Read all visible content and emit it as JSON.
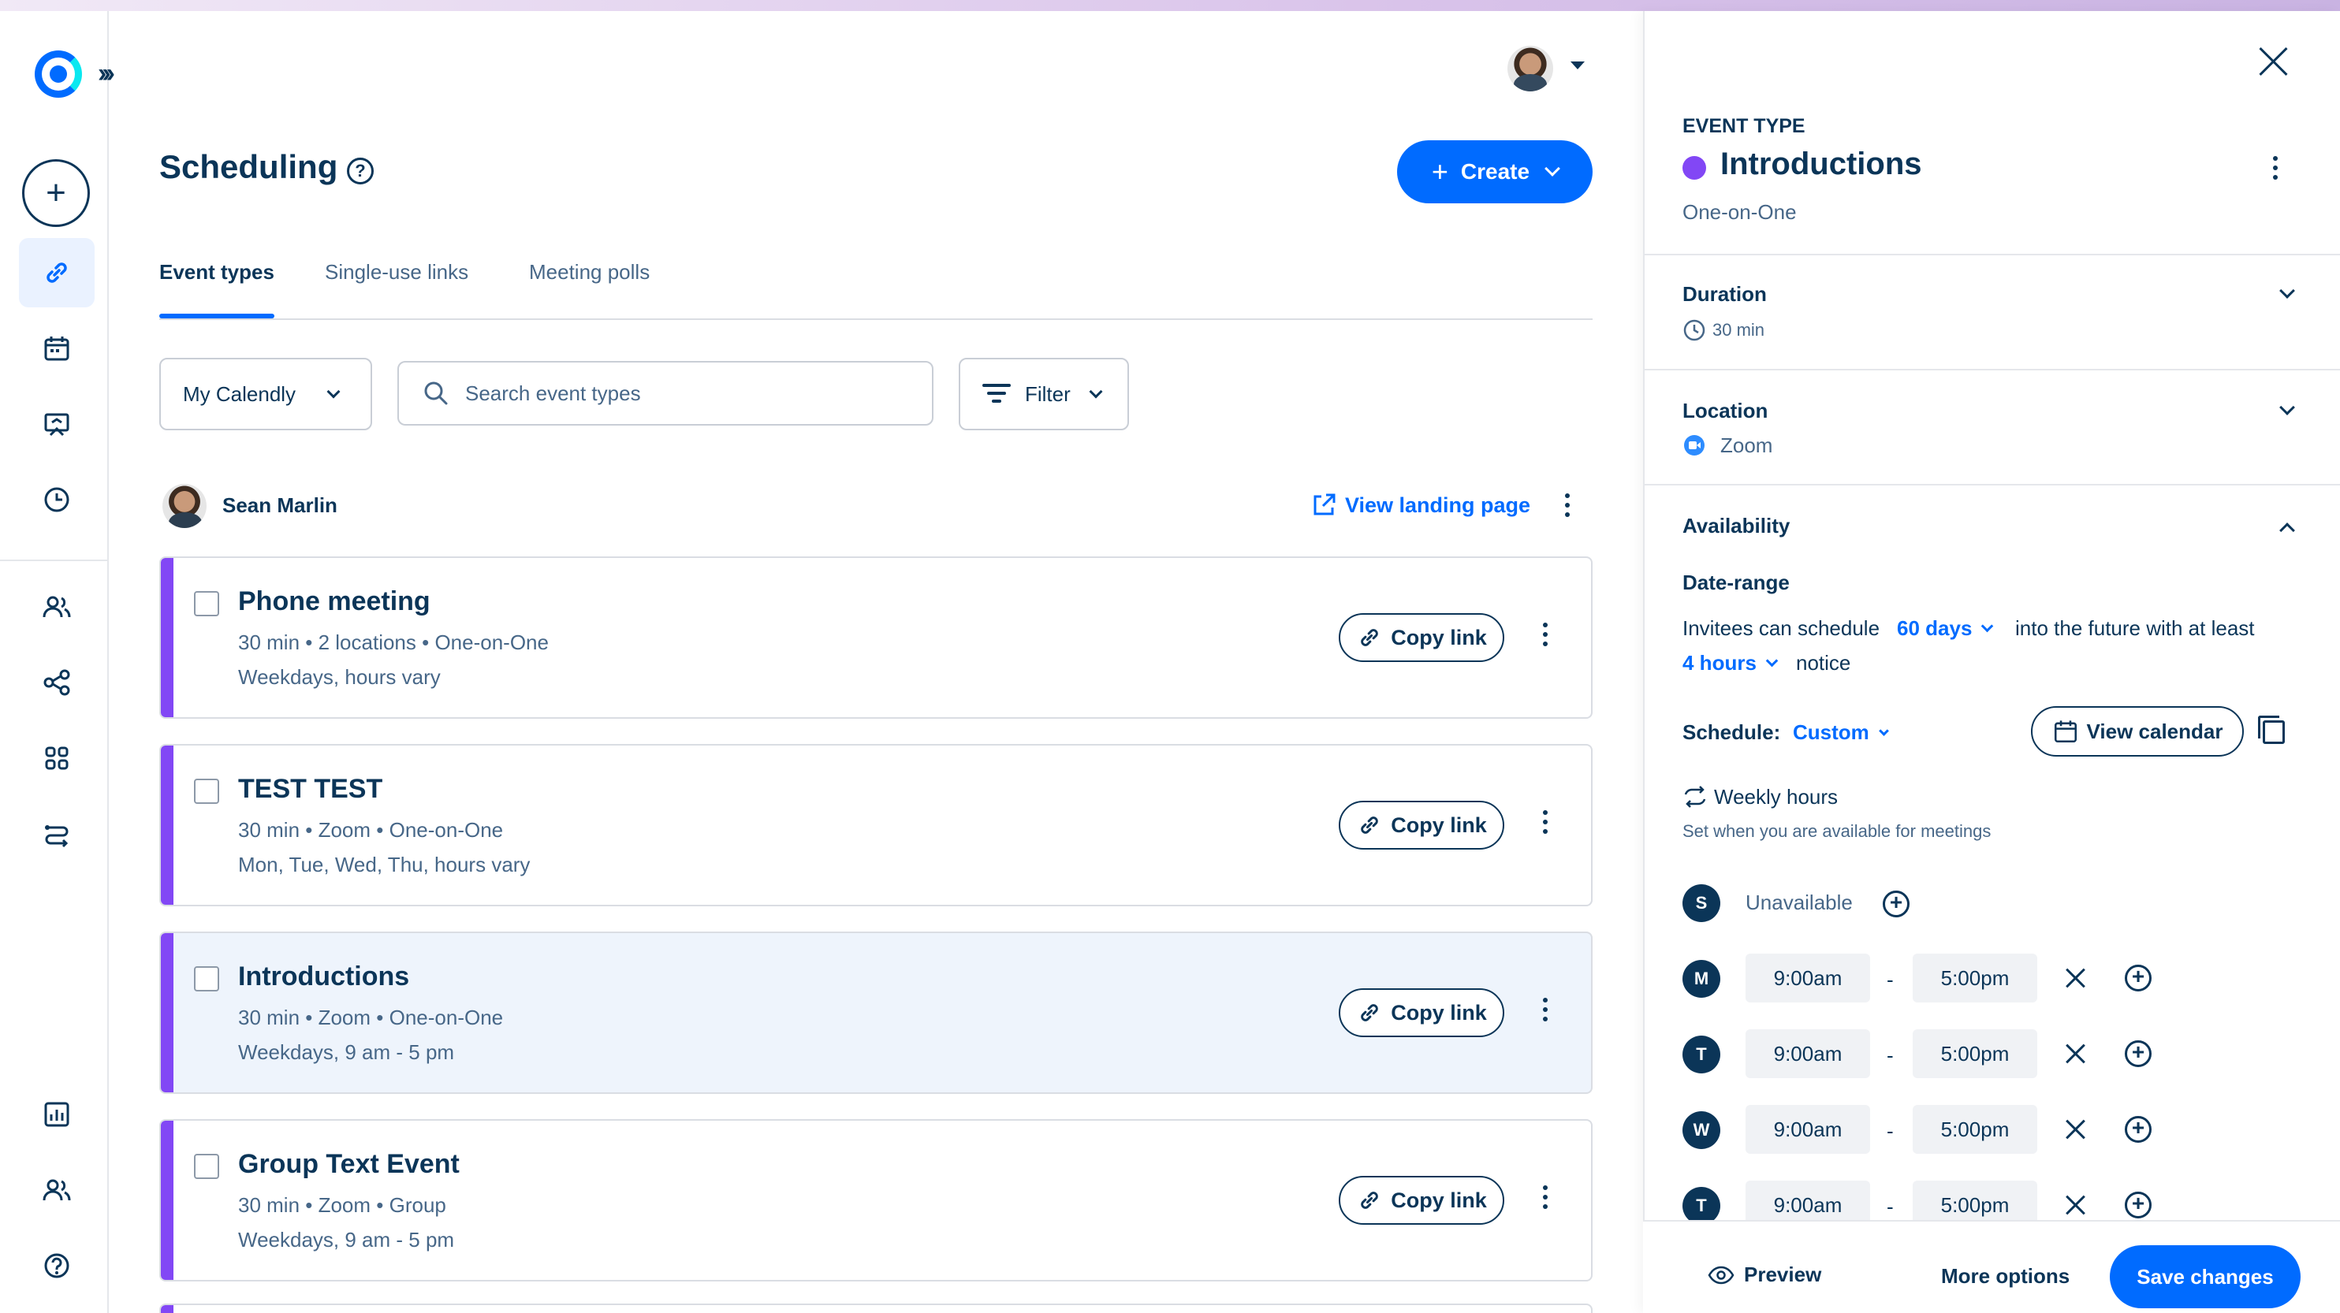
{
  "colors": {
    "accent": "#006bff",
    "text_primary": "#0b3558",
    "text_secondary": "#476788",
    "event_stripe": "#8247f5",
    "selected_card_bg": "#eef4fc"
  },
  "rail": {
    "icons": [
      "calendly-logo-icon",
      "expand-icon",
      "plus-icon",
      "link-icon",
      "calendar-icon",
      "meetings-icon",
      "clock-icon",
      "contacts-icon",
      "workflows-icon",
      "apps-icon",
      "routing-icon",
      "analytics-icon",
      "admin-icon",
      "help-icon"
    ]
  },
  "header": {
    "title": "Scheduling",
    "create_label": "Create"
  },
  "tabs": [
    {
      "label": "Event types",
      "active": true
    },
    {
      "label": "Single-use links",
      "active": false
    },
    {
      "label": "Meeting polls",
      "active": false
    }
  ],
  "filters": {
    "account_select": "My Calendly",
    "search_placeholder": "Search event types",
    "filter_label": "Filter"
  },
  "owner": {
    "name": "Sean Marlin",
    "landing_link": "View landing page"
  },
  "events": [
    {
      "title": "Phone meeting",
      "meta": "30 min • 2 locations • One-on-One",
      "hours": "Weekdays, hours vary",
      "copy_label": "Copy link",
      "selected": false
    },
    {
      "title": "TEST TEST",
      "meta": "30 min • Zoom • One-on-One",
      "hours": "Mon, Tue, Wed, Thu, hours vary",
      "copy_label": "Copy link",
      "selected": false
    },
    {
      "title": "Introductions",
      "meta": "30 min • Zoom • One-on-One",
      "hours": "Weekdays, 9 am - 5 pm",
      "copy_label": "Copy link",
      "selected": true
    },
    {
      "title": "Group Text Event",
      "meta": "30 min • Zoom • Group",
      "hours": "Weekdays, 9 am - 5 pm",
      "copy_label": "Copy link",
      "selected": false
    }
  ],
  "panel": {
    "eyebrow": "EVENT TYPE",
    "title": "Introductions",
    "subtitle": "One-on-One",
    "dot_color": "#8247f5",
    "duration_label": "Duration",
    "duration_value": "30 min",
    "location_label": "Location",
    "location_value": "Zoom",
    "availability_label": "Availability",
    "date_range_label": "Date-range",
    "invitees_prefix": "Invitees can schedule",
    "days_value": "60 days",
    "invitees_suffix": "into the future with at least",
    "notice_value": "4 hours",
    "notice_suffix": "notice",
    "schedule_label": "Schedule:",
    "schedule_value": "Custom",
    "view_calendar_label": "View calendar",
    "weekly_hours_label": "Weekly hours",
    "weekly_hours_help": "Set when you are available for meetings",
    "unavailable_label": "Unavailable",
    "dash": "-",
    "days": [
      {
        "letter": "S"
      },
      {
        "letter": "M",
        "start": "9:00am",
        "end": "5:00pm"
      },
      {
        "letter": "T",
        "start": "9:00am",
        "end": "5:00pm"
      },
      {
        "letter": "W",
        "start": "9:00am",
        "end": "5:00pm"
      },
      {
        "letter": "T",
        "start": "9:00am",
        "end": "5:00pm"
      }
    ],
    "footer": {
      "preview_label": "Preview",
      "more_label": "More options",
      "save_label": "Save changes"
    }
  }
}
